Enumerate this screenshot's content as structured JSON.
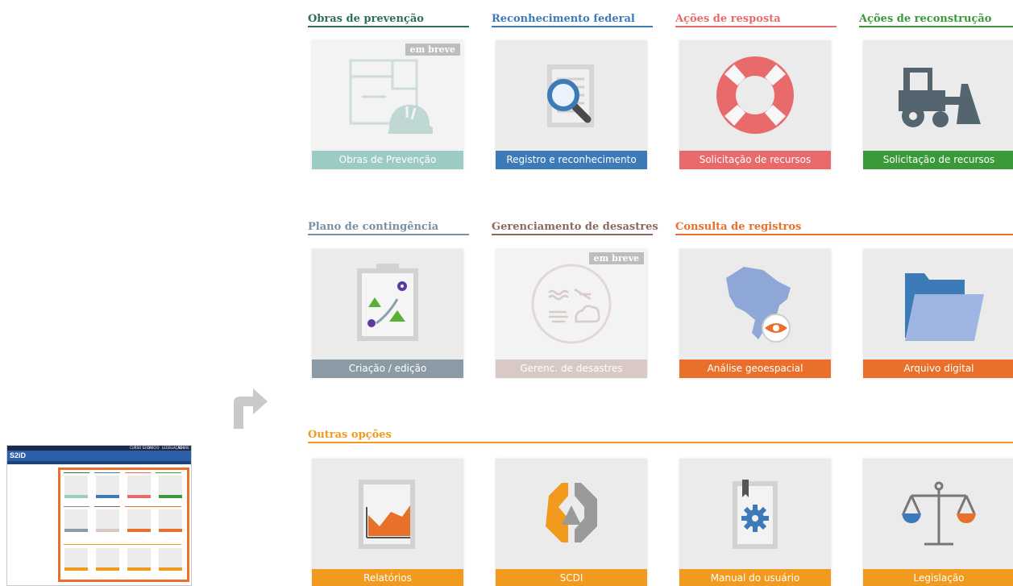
{
  "thumbnail": {
    "brand": "S2iD",
    "nav": [
      "CURSO S2ID",
      "INÍCIO",
      "LEGISLAÇÃO",
      "SOBRE O SISTEMA"
    ],
    "frame_color": "#e8702a"
  },
  "sections": [
    {
      "id": "obras",
      "title": "Obras de prevenção",
      "color": "#2e6e5e"
    },
    {
      "id": "reconhecimento",
      "title": "Reconhecimento federal",
      "color": "#3d7ab8"
    },
    {
      "id": "resposta",
      "title": "Ações de resposta",
      "color": "#e86a6a"
    },
    {
      "id": "reconstrucao",
      "title": "Ações de reconstrução",
      "color": "#3a9a3a"
    },
    {
      "id": "contingencia",
      "title": "Plano de contingência",
      "color": "#7a8fa0"
    },
    {
      "id": "desastres",
      "title": "Gerenciamento de desastres",
      "color": "#8a6a60"
    },
    {
      "id": "consulta",
      "title": "Consulta de registros",
      "color": "#e8702a"
    },
    {
      "id": "outras",
      "title": "Outras opções",
      "color": "#f29a1e"
    }
  ],
  "tiles": [
    {
      "label": "Obras de Prevenção",
      "color": "#9ccbc4",
      "badge": "em breve",
      "icon": "construction-plan-helmet-icon"
    },
    {
      "label": "Registro e reconhecimento",
      "color": "#3d7ab8",
      "icon": "document-search-icon"
    },
    {
      "label": "Solicitação de recursos",
      "color": "#e86a6a",
      "icon": "lifebuoy-icon"
    },
    {
      "label": "Solicitação de recursos",
      "color": "#3a9a3a",
      "icon": "bulldozer-icon"
    },
    {
      "label": "Criação / edição",
      "color": "#8a9ba5",
      "icon": "clipboard-map-icon"
    },
    {
      "label": "Gerenc. de desastres",
      "color": "#d8c9c5",
      "badge": "em breve",
      "icon": "weather-hazard-icon"
    },
    {
      "label": "Análise geoespacial",
      "color": "#e8702a",
      "icon": "brazil-map-eye-icon"
    },
    {
      "label": "Arquivo digital",
      "color": "#e8702a",
      "icon": "folder-icon"
    },
    {
      "label": "Relatórios",
      "color": "#f29a1e",
      "icon": "report-chart-icon"
    },
    {
      "label": "SCDI",
      "color": "#f29a1e",
      "icon": "scdi-logo-icon"
    },
    {
      "label": "Manual do usuário",
      "color": "#f29a1e",
      "icon": "manual-gear-icon"
    },
    {
      "label": "Legislação",
      "color": "#f29a1e",
      "icon": "scales-icon"
    }
  ]
}
